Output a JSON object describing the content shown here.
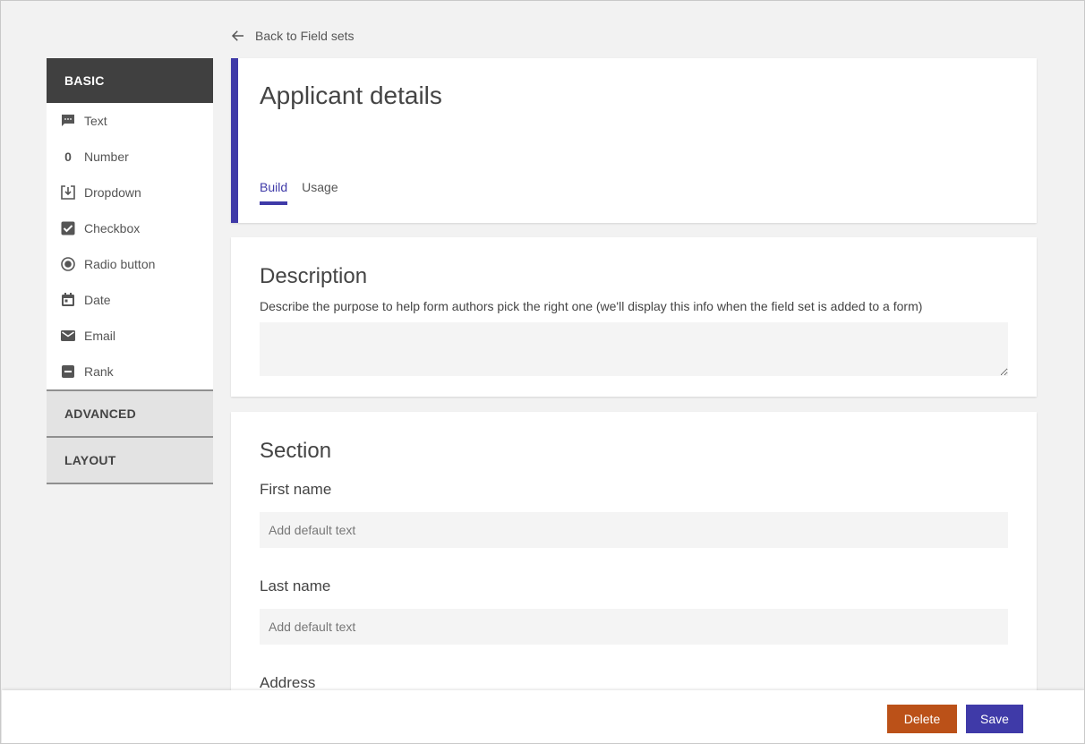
{
  "back_link": {
    "label": "Back to Field sets",
    "icon": "arrow-left-icon"
  },
  "sidebar": {
    "categories": [
      {
        "label": "BASIC",
        "expanded": true
      },
      {
        "label": "ADVANCED",
        "expanded": false
      },
      {
        "label": "LAYOUT",
        "expanded": false
      }
    ],
    "basic_items": [
      {
        "label": "Text",
        "icon": "text-field-icon"
      },
      {
        "label": "Number",
        "icon": "number-icon",
        "glyph": "0"
      },
      {
        "label": "Dropdown",
        "icon": "dropdown-icon"
      },
      {
        "label": "Checkbox",
        "icon": "checkbox-icon"
      },
      {
        "label": "Radio button",
        "icon": "radio-button-icon"
      },
      {
        "label": "Date",
        "icon": "calendar-icon"
      },
      {
        "label": "Email",
        "icon": "email-icon"
      },
      {
        "label": "Rank",
        "icon": "rank-icon"
      }
    ]
  },
  "header": {
    "title": "Applicant details",
    "tabs": [
      {
        "label": "Build",
        "active": true
      },
      {
        "label": "Usage",
        "active": false
      }
    ]
  },
  "description": {
    "heading": "Description",
    "help_text": "Describe the purpose to help form authors pick the right one (we'll display this info when the field set is added to a form)",
    "value": ""
  },
  "section": {
    "heading": "Section",
    "fields": [
      {
        "label": "First name",
        "placeholder": "Add default text"
      },
      {
        "label": "Last name",
        "placeholder": "Add default text"
      },
      {
        "label": "Address",
        "placeholder": ""
      }
    ]
  },
  "footer": {
    "delete_label": "Delete",
    "save_label": "Save"
  },
  "colors": {
    "accent": "#3f3aa8",
    "danger": "#bb5118",
    "sidebar_active": "#404040"
  }
}
